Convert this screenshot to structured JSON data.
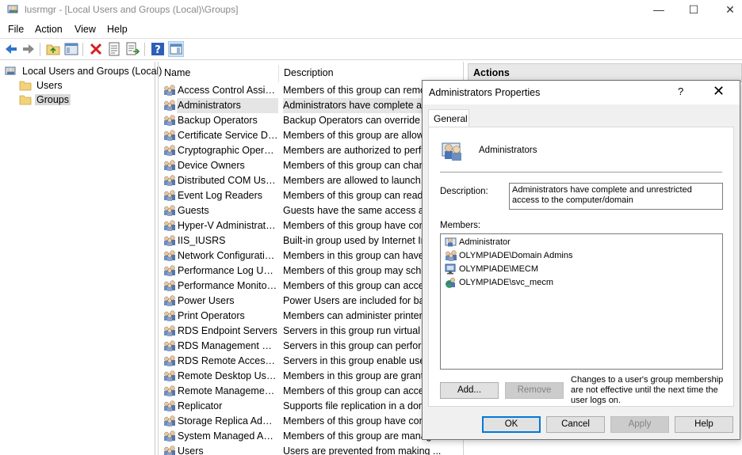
{
  "window": {
    "title": "lusrmgr - [Local Users and Groups (Local)\\Groups]",
    "minimize": "—",
    "maximize": "☐",
    "close": "✕"
  },
  "menu": [
    "File",
    "Action",
    "View",
    "Help"
  ],
  "tree": {
    "root": "Local Users and Groups (Local)",
    "children": [
      "Users",
      "Groups"
    ],
    "selected": "Groups"
  },
  "list": {
    "columns": [
      "Name",
      "Description"
    ],
    "rows": [
      {
        "name": "Access Control Assist...",
        "desc": "Members of this group can remot..."
      },
      {
        "name": "Administrators",
        "desc": "Administrators have complete an..."
      },
      {
        "name": "Backup Operators",
        "desc": "Backup Operators can override se..."
      },
      {
        "name": "Certificate Service DC...",
        "desc": "Members of this group are allowe..."
      },
      {
        "name": "Cryptographic Operat...",
        "desc": "Members are authorized to perfo..."
      },
      {
        "name": "Device Owners",
        "desc": "Members of this group can chang..."
      },
      {
        "name": "Distributed COM Users",
        "desc": "Members are allowed to launch, a..."
      },
      {
        "name": "Event Log Readers",
        "desc": "Members of this group can read e..."
      },
      {
        "name": "Guests",
        "desc": "Guests have the same access as m..."
      },
      {
        "name": "Hyper-V Administrators",
        "desc": "Members of this group have comp..."
      },
      {
        "name": "IIS_IUSRS",
        "desc": "Built-in group used by Internet Inf..."
      },
      {
        "name": "Network Configuratio...",
        "desc": "Members in this group can have s..."
      },
      {
        "name": "Performance Log Users",
        "desc": "Members of this group may sched..."
      },
      {
        "name": "Performance Monitor ...",
        "desc": "Members of this group can access..."
      },
      {
        "name": "Power Users",
        "desc": "Power Users are included for back..."
      },
      {
        "name": "Print Operators",
        "desc": "Members can administer printers..."
      },
      {
        "name": "RDS Endpoint Servers",
        "desc": "Servers in this group run virtual m..."
      },
      {
        "name": "RDS Management Ser...",
        "desc": "Servers in this group can perform..."
      },
      {
        "name": "RDS Remote Access S...",
        "desc": "Servers in this group enable users..."
      },
      {
        "name": "Remote Desktop Users",
        "desc": "Members in this group are grante..."
      },
      {
        "name": "Remote Management...",
        "desc": "Members of this group can access..."
      },
      {
        "name": "Replicator",
        "desc": "Supports file replication in a dom..."
      },
      {
        "name": "Storage Replica Admi...",
        "desc": "Members of this group have comp..."
      },
      {
        "name": "System Managed Acc...",
        "desc": "Members of this group are manag..."
      },
      {
        "name": "Users",
        "desc": "Users are prevented from making ..."
      }
    ],
    "selected_index": 1
  },
  "actions": {
    "title": "Actions"
  },
  "dialog": {
    "title": "Administrators Properties",
    "help": "?",
    "close": "✕",
    "tab": "General",
    "group_name": "Administrators",
    "description_label": "Description:",
    "description": "Administrators have complete and unrestricted access to the computer/domain",
    "members_label": "Members:",
    "members": [
      {
        "name": "Administrator",
        "icon": "user-icon"
      },
      {
        "name": "OLYMPIADE\\Domain Admins",
        "icon": "domain-group-icon"
      },
      {
        "name": "OLYMPIADE\\MECM",
        "icon": "computer-icon"
      },
      {
        "name": "OLYMPIADE\\svc_mecm",
        "icon": "domain-user-icon"
      }
    ],
    "add_button": "Add...",
    "remove_button": "Remove",
    "note": "Changes to a user's group membership are not effective until the next time the user logs on.",
    "ok_button": "OK",
    "cancel_button": "Cancel",
    "apply_button": "Apply",
    "help_button": "Help"
  }
}
